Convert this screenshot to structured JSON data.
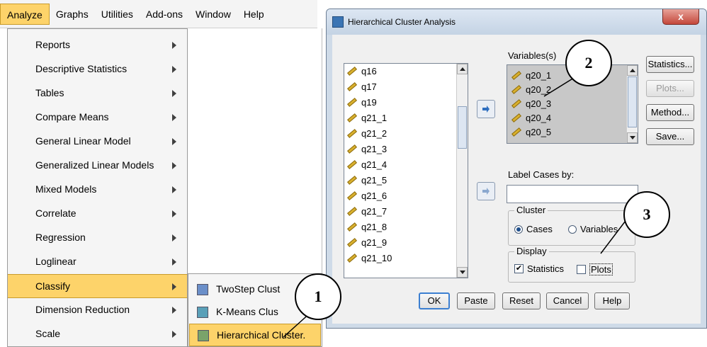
{
  "menubar": {
    "items": [
      "Analyze",
      "Graphs",
      "Utilities",
      "Add-ons",
      "Window",
      "Help"
    ],
    "active_item": "Analyze"
  },
  "analyze_menu": {
    "items": [
      {
        "label": "Reports"
      },
      {
        "label": "Descriptive Statistics"
      },
      {
        "label": "Tables"
      },
      {
        "label": "Compare Means"
      },
      {
        "label": "General Linear Model"
      },
      {
        "label": "Generalized Linear Models"
      },
      {
        "label": "Mixed Models"
      },
      {
        "label": "Correlate"
      },
      {
        "label": "Regression"
      },
      {
        "label": "Loglinear"
      },
      {
        "label": "Classify"
      },
      {
        "label": "Dimension Reduction"
      },
      {
        "label": "Scale"
      }
    ],
    "selected_item": "Classify"
  },
  "classify_submenu": {
    "items": [
      {
        "label": "TwoStep Clust",
        "icon": "twostep-cluster-icon"
      },
      {
        "label": "K-Means Clus",
        "icon": "kmeans-cluster-icon"
      },
      {
        "label": "Hierarchical Cluster.",
        "icon": "hierarchical-cluster-icon"
      }
    ],
    "selected_item": "Hierarchical Cluster."
  },
  "dialog": {
    "title": "Hierarchical Cluster Analysis",
    "close_label": "x",
    "source_list": [
      "q16",
      "q17",
      "q19",
      "q21_1",
      "q21_2",
      "q21_3",
      "q21_4",
      "q21_5",
      "q21_6",
      "q21_7",
      "q21_8",
      "q21_9",
      "q21_10"
    ],
    "variables_label": "Variables(s)",
    "variables": [
      "q20_1",
      "q20_2",
      "q20_3",
      "q20_4",
      "q20_5"
    ],
    "label_cases_label": "Label Cases by:",
    "label_cases_value": "",
    "cluster_group": {
      "title": "Cluster",
      "options": [
        "Cases",
        "Variables"
      ],
      "selected": "Cases"
    },
    "display_group": {
      "title": "Display",
      "statistics_label": "Statistics",
      "statistics_checked": true,
      "plots_label": "Plots",
      "plots_checked": false
    },
    "side_buttons": {
      "statistics": "Statistics...",
      "plots": "Plots...",
      "method": "Method...",
      "save": "Save..."
    },
    "bottom_buttons": {
      "ok": "OK",
      "paste": "Paste",
      "reset": "Reset",
      "cancel": "Cancel",
      "help": "Help"
    }
  },
  "callouts": [
    "1",
    "2",
    "3"
  ],
  "colors": {
    "menu_highlight": "#fdd36a",
    "dialog_frame": "#cfdbe8",
    "variables_box": "#c8c8c8"
  }
}
